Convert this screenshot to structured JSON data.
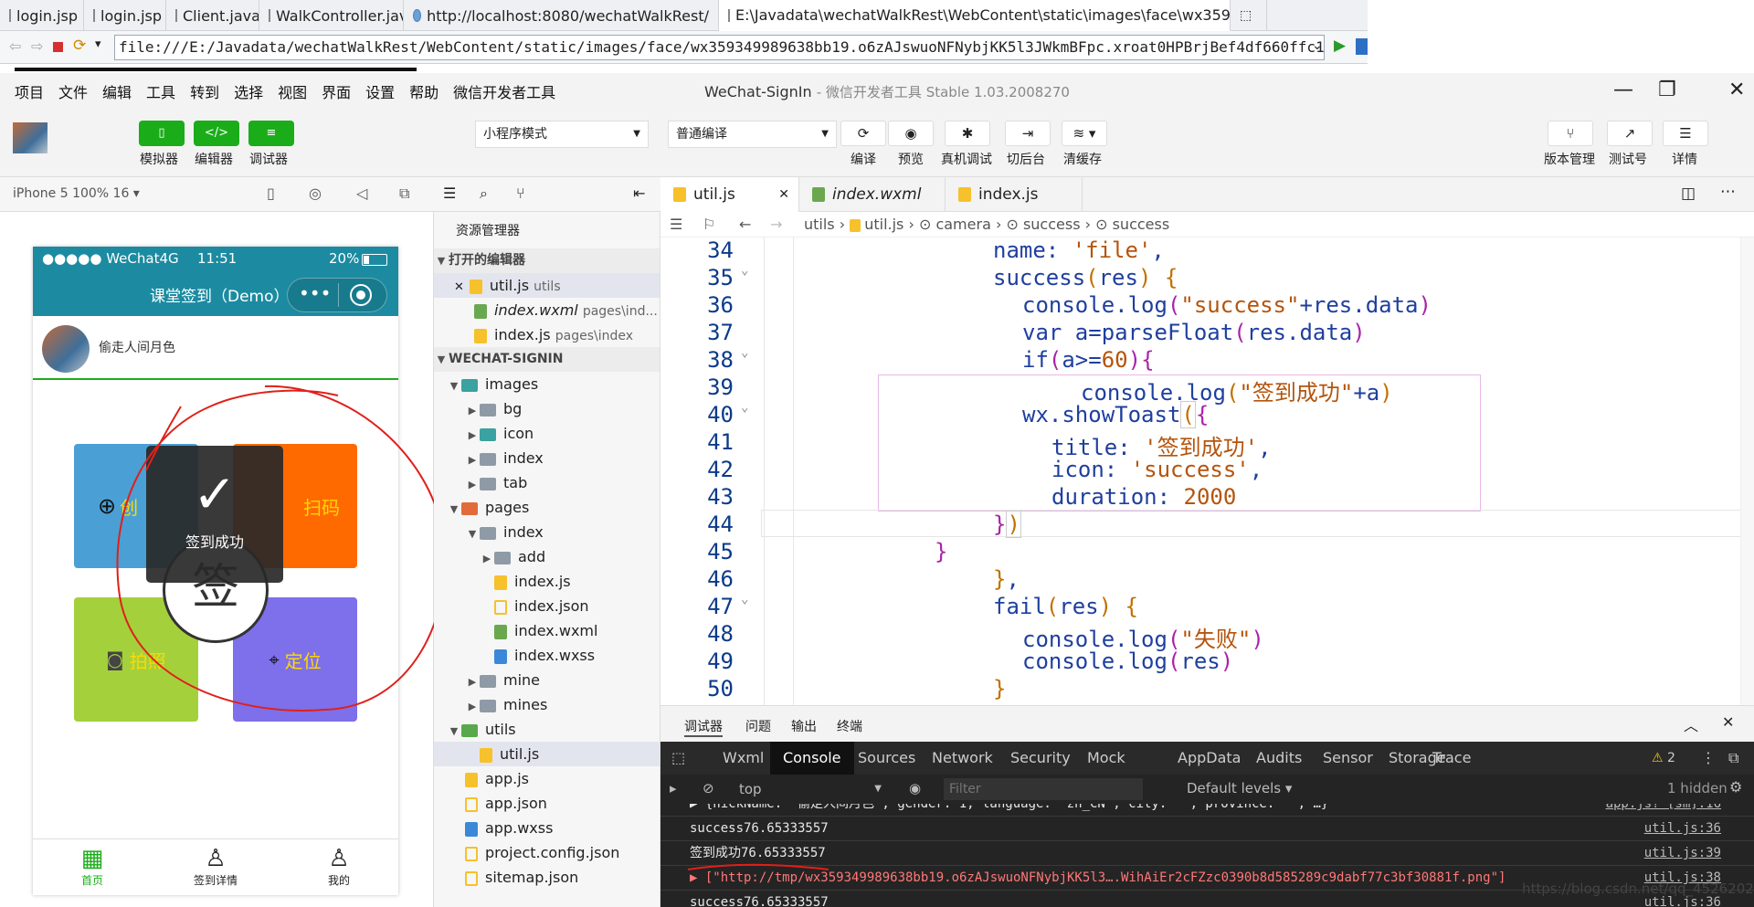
{
  "browser": {
    "tabs": [
      "login.jsp",
      "login.jsp",
      "Client.java",
      "WalkController.java",
      "http://localhost:8080/wechatWalkRest/",
      "E:\\Javadata\\wechatWalkRest\\WebContent\\static\\images\\face\\wx35934..."
    ],
    "address": "file:///E:/Javadata/wechatWalkRest/WebContent/static/images/face/wx359349989638bb19.o6zAJswuoNFNybjKK5l3JWkmBFpc.xroat0HPBrjBef4df660ffc192b54bbcd8d811ed3401..."
  },
  "menubar": {
    "items": [
      "项目",
      "文件",
      "编辑",
      "工具",
      "转到",
      "选择",
      "视图",
      "界面",
      "设置",
      "帮助",
      "微信开发者工具"
    ],
    "title": "WeChat-SignIn",
    "subtitle": "- 微信开发者工具 Stable 1.03.2008270"
  },
  "toolbar": {
    "simulator": "模拟器",
    "editor": "编辑器",
    "debugger": "调试器",
    "mode": "小程序模式",
    "compile_mode": "普通编译",
    "compile": "编译",
    "preview": "预览",
    "real_debug": "真机调试",
    "background": "切后台",
    "clear_cache": "清缓存",
    "version": "版本管理",
    "test_account": "测试号",
    "details": "详情"
  },
  "simulator": {
    "device": "iPhone 5 100% 16 ▾",
    "status_left": "●●●●● WeChat4G",
    "status_time": "11:51",
    "status_battery": "20%",
    "nav_title": "课堂签到（Demo）",
    "username": "偷走人间月色",
    "tile_create": "创",
    "tile_scan": "扫码",
    "tile_photo": "拍照",
    "tile_locate": "定位",
    "sign_char": "签",
    "toast": "签到成功",
    "tabs": [
      "首页",
      "签到详情",
      "我的"
    ],
    "colors": {
      "nav": "#1c8ba1",
      "blue": "#4aa0d5",
      "orange": "#ff6a00",
      "green": "#a4d03c",
      "purple": "#7e6fea",
      "tab_active": "#1aad19"
    }
  },
  "explorer": {
    "title": "资源管理器",
    "open_editors": "打开的编辑器",
    "open_files": [
      {
        "name": "util.js",
        "path": "utils"
      },
      {
        "name": "index.wxml",
        "path": "pages\\ind..."
      },
      {
        "name": "index.js",
        "path": "pages\\index"
      }
    ],
    "project": "WECHAT-SIGNIN",
    "tree": [
      "images",
      "bg",
      "icon",
      "index",
      "tab",
      "pages",
      "index",
      "add",
      "index.js",
      "index.json",
      "index.wxml",
      "index.wxss",
      "mine",
      "mines",
      "utils",
      "util.js",
      "app.js",
      "app.json",
      "app.wxss",
      "project.config.json",
      "sitemap.json"
    ]
  },
  "editor": {
    "tabs": [
      "util.js",
      "index.wxml",
      "index.js"
    ],
    "breadcrumb": [
      "utils",
      "util.js",
      "camera",
      "success",
      "success"
    ],
    "line_numbers": [
      "34",
      "35",
      "36",
      "37",
      "38",
      "39",
      "40",
      "41",
      "42",
      "43",
      "44",
      "45",
      "46",
      "47",
      "48",
      "49",
      "50"
    ]
  },
  "console": {
    "header_tabs": [
      "调试器",
      "问题",
      "输出",
      "终端"
    ],
    "tabs": [
      "Wxml",
      "Console",
      "Sources",
      "Network",
      "Security",
      "Mock",
      "AppData",
      "Audits",
      "Sensor",
      "Storage",
      "Trace"
    ],
    "warnings": "2",
    "context": "top",
    "filter_placeholder": "Filter",
    "levels": "Default levels ▾",
    "hidden": "1 hidden",
    "logs": [
      {
        "text": "▶ {nickName: \"偷走人间月色\", gender: 1, language: \"zh_CN\", city: \"\", province: \"\", …}",
        "src": "app.js? [sm]:16"
      },
      {
        "text": "success76.65333557",
        "src": "util.js:36"
      },
      {
        "text": "签到成功76.65333557",
        "src": "util.js:39"
      },
      {
        "text": "▶ [\"http://tmp/wx359349989638bb19.o6zAJswuoNFNybjKK5l3….WihAiEr2cFZzc0390b8d585289c9dabf77c3bf30881f.png\"]",
        "src": "util.js:38"
      },
      {
        "text": "success76.65333557",
        "src": "util.js:36"
      }
    ]
  },
  "watermark": "https://blog.csdn.net/qq_45262026"
}
